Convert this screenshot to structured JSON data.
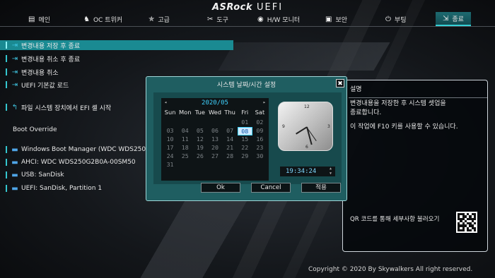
{
  "brand": {
    "name": "ASRock",
    "product": "UEFI"
  },
  "tabs": [
    {
      "label": "메인",
      "icon": "list-icon"
    },
    {
      "label": "OC 트위커",
      "icon": "rocket-icon"
    },
    {
      "label": "고급",
      "icon": "star-icon"
    },
    {
      "label": "도구",
      "icon": "tools-icon"
    },
    {
      "label": "H/W 모니터",
      "icon": "gauge-icon"
    },
    {
      "label": "보안",
      "icon": "shield-icon"
    },
    {
      "label": "부팅",
      "icon": "power-icon"
    },
    {
      "label": "종료",
      "icon": "exit-icon"
    }
  ],
  "active_tab": "종료",
  "menu": {
    "items": [
      {
        "label": "변경내용 저장 후 종료"
      },
      {
        "label": "변경내용 취소 후 종료"
      },
      {
        "label": "변경내용 취소"
      },
      {
        "label": "UEFI 기본값 로드"
      },
      {
        "label": "파일 시스템 장치에서 EFI 셸 시작"
      }
    ],
    "boot_override_label": "Boot Override",
    "boot_items": [
      {
        "label": "Windows Boot Manager (WDC WDS250G2B0"
      },
      {
        "label": "AHCI:  WDC WDS250G2B0A-00SM50"
      },
      {
        "label": "USB: SanDisk"
      },
      {
        "label": "UEFI: SanDisk, Partition 1"
      }
    ]
  },
  "description": {
    "title": "설명",
    "line1": "변경내용을 저장한 후 시스템 셋업을",
    "line2": "종료합니다.",
    "line3": "이 작업에 F10 키를 사용할 수 있습니다.",
    "qr_label": "QR 코드를 통해 세부사항 불러오기"
  },
  "dialog": {
    "title": "시스템 날짜/시간 설정",
    "close": "✖",
    "month": "2020/05",
    "weekdays": [
      "Sun",
      "Mon",
      "Tue",
      "Wed",
      "Thu",
      "Fri",
      "Sat"
    ],
    "days": [
      "",
      "",
      "",
      "",
      "",
      "01",
      "02",
      "03",
      "04",
      "05",
      "06",
      "07",
      "08",
      "09",
      "10",
      "11",
      "12",
      "13",
      "14",
      "15",
      "16",
      "17",
      "18",
      "19",
      "20",
      "21",
      "22",
      "23",
      "24",
      "25",
      "26",
      "27",
      "28",
      "29",
      "30",
      "31"
    ],
    "selected_day": "08",
    "time": "19:34:24",
    "clock_numbers": {
      "twelve": "12",
      "three": "3",
      "six": "6",
      "nine": "9"
    },
    "ok_label": "Ok",
    "cancel_label": "Cancel",
    "apply_label": "적용"
  },
  "footer": {
    "text": "Copyright © 2020 By Skywalkers All right reserved."
  },
  "colors": {
    "accent": "#1a8a92",
    "highlight": "#3fd3ff",
    "dialog": "#1f5e61"
  }
}
